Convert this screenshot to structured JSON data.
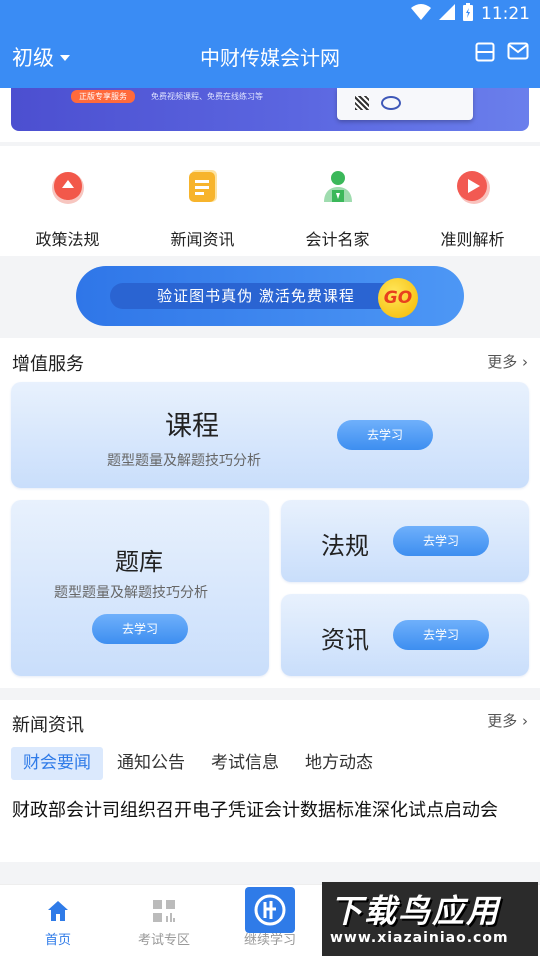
{
  "status_bar": {
    "time": "11:21"
  },
  "header": {
    "level_label": "初级",
    "title": "中财传媒会计网"
  },
  "banner": {
    "tag": "正版专享服务",
    "text": "免费视频课程、免费在线练习等"
  },
  "categories": [
    {
      "label": "政策法规",
      "icon": "policy-icon",
      "color": "#f2584a"
    },
    {
      "label": "新闻资讯",
      "icon": "news-icon",
      "color": "#f7b42c"
    },
    {
      "label": "会计名家",
      "icon": "person-icon",
      "color": "#3bb85a"
    },
    {
      "label": "准则解析",
      "icon": "play-icon",
      "color": "#f25a52"
    }
  ],
  "verify": {
    "label": "验证图书真伪   激活免费课程",
    "go": "GO"
  },
  "services": {
    "title": "增值服务",
    "more": "更多",
    "course": {
      "title": "课程",
      "subtitle": "题型题量及解题技巧分析",
      "button": "去学习"
    },
    "bank": {
      "title": "题库",
      "subtitle": "题型题量及解题技巧分析",
      "button": "去学习"
    },
    "law": {
      "title": "法规",
      "button": "去学习"
    },
    "info": {
      "title": "资讯",
      "button": "去学习"
    }
  },
  "news": {
    "title": "新闻资讯",
    "more": "更多",
    "tabs": [
      "财会要闻",
      "通知公告",
      "考试信息",
      "地方动态"
    ],
    "active_tab": 0,
    "headline": "财政部会计司组织召开电子凭证会计数据标准深化试点启动会"
  },
  "bottom_nav": [
    {
      "label": "首页",
      "icon": "home-icon",
      "active": true
    },
    {
      "label": "考试专区",
      "icon": "grid-icon",
      "active": false
    },
    {
      "label": "继续学习",
      "icon": "learn-icon",
      "active": false
    }
  ],
  "watermark": {
    "big": "下载鸟应用",
    "small": "www.xiazainiao.com"
  },
  "colors": {
    "primary": "#3a8cf4",
    "accent": "#2f7be8"
  }
}
